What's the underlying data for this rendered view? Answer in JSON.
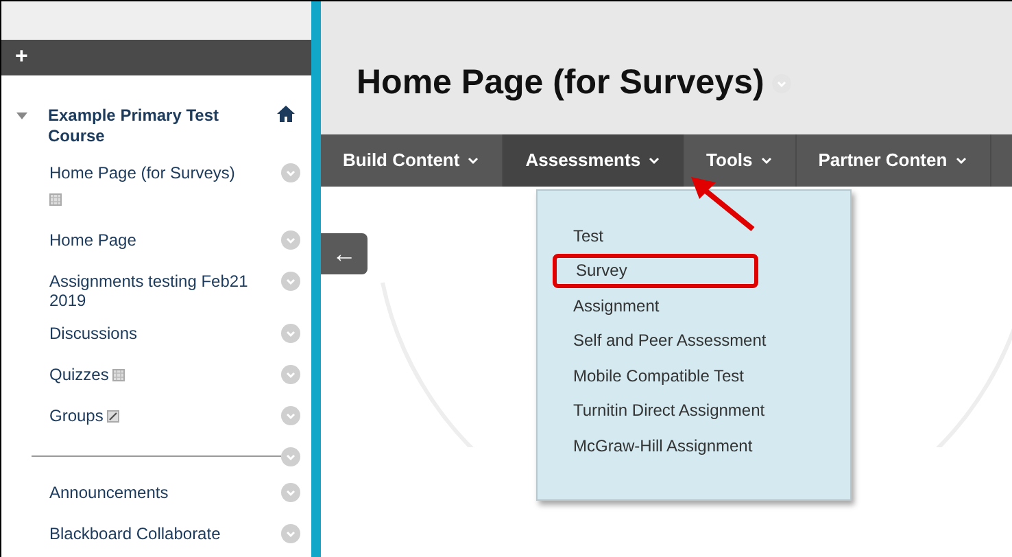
{
  "sidebar": {
    "add_label": "+",
    "course": {
      "title": "Example Primary Test Course"
    },
    "items": [
      {
        "kind": "boxed",
        "label": "Home Page (for Surveys)"
      },
      {
        "kind": "plain",
        "label": "Home Page"
      },
      {
        "kind": "plain",
        "label": "Assignments testing Feb21 2019"
      },
      {
        "kind": "plain",
        "label": "Discussions"
      },
      {
        "kind": "inline-box",
        "label": "Quizzes"
      },
      {
        "kind": "inline-edit",
        "label": "Groups"
      },
      {
        "kind": "divider"
      },
      {
        "kind": "plain",
        "label": "Announcements"
      },
      {
        "kind": "plain",
        "label": "Blackboard Collaborate"
      }
    ]
  },
  "collapse_button": {
    "label": "←"
  },
  "page": {
    "title": "Home Page (for Surveys)"
  },
  "nav": [
    {
      "label": "Build Content",
      "selected": false
    },
    {
      "label": "Assessments",
      "selected": true
    },
    {
      "label": "Tools",
      "selected": false
    },
    {
      "label": "Partner Conten",
      "selected": false
    }
  ],
  "dropdown": {
    "items": [
      {
        "label": "Test",
        "highlighted": false
      },
      {
        "label": "Survey",
        "highlighted": true
      },
      {
        "label": "Assignment",
        "highlighted": false
      },
      {
        "label": "Self and Peer Assessment",
        "highlighted": false
      },
      {
        "label": "Mobile Compatible Test",
        "highlighted": false
      },
      {
        "label": "Turnitin Direct Assignment",
        "highlighted": false
      },
      {
        "label": "McGraw-Hill Assignment",
        "highlighted": false
      }
    ]
  }
}
